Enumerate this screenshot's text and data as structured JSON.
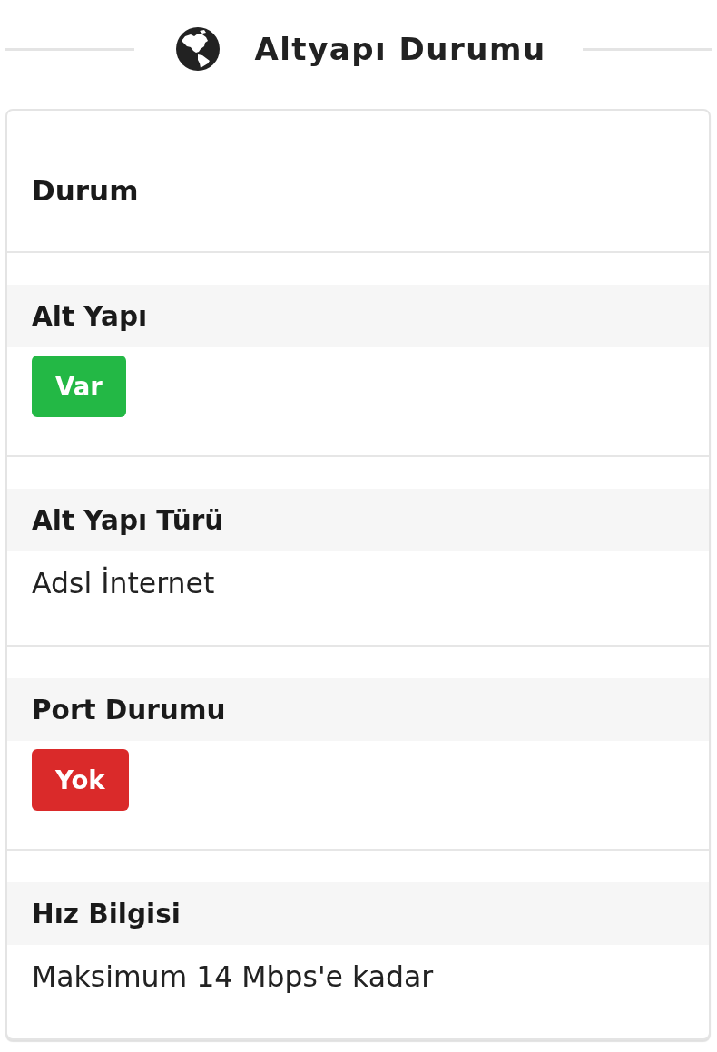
{
  "heading": {
    "title": "Altyapı Durumu"
  },
  "card": {
    "title": "Durum",
    "fields": [
      {
        "label": "Alt Yapı",
        "kind": "badge",
        "value": "Var",
        "color": "#23b845"
      },
      {
        "label": "Alt Yapı Türü",
        "kind": "text",
        "value": "Adsl İnternet"
      },
      {
        "label": "Port Durumu",
        "kind": "badge",
        "value": "Yok",
        "color": "#da2a2a"
      },
      {
        "label": "Hız Bilgisi",
        "kind": "text",
        "value": "Maksimum 14 Mbps'e kadar"
      }
    ]
  }
}
